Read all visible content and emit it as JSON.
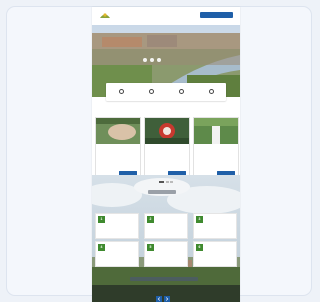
{
  "header": {
    "brand": "",
    "cta_label": ""
  },
  "hero": {
    "title": "",
    "subtitle": ""
  },
  "quick_links": [
    {
      "label": ""
    },
    {
      "label": ""
    },
    {
      "label": ""
    },
    {
      "label": ""
    }
  ],
  "section_news": {
    "title": ""
  },
  "news": [
    {
      "title": "",
      "text": "",
      "button": ""
    },
    {
      "title": "",
      "text": "",
      "button": ""
    },
    {
      "title": "",
      "text": "",
      "button": ""
    }
  ],
  "section_tiles": {
    "title": ""
  },
  "tiles": [
    {
      "number": "1",
      "title": ""
    },
    {
      "number": "2",
      "title": ""
    },
    {
      "number": "3",
      "title": ""
    },
    {
      "number": "4",
      "title": ""
    },
    {
      "number": "5",
      "title": ""
    },
    {
      "number": "6",
      "title": ""
    }
  ],
  "colors": {
    "primary": "#1f5fa8",
    "accent_green": "#3f8a2f",
    "logo_green": "#8aa33b",
    "logo_yellow": "#e2b62b"
  },
  "icons": [
    "logo-icon",
    "quick-link-icon",
    "arrow-icon"
  ]
}
